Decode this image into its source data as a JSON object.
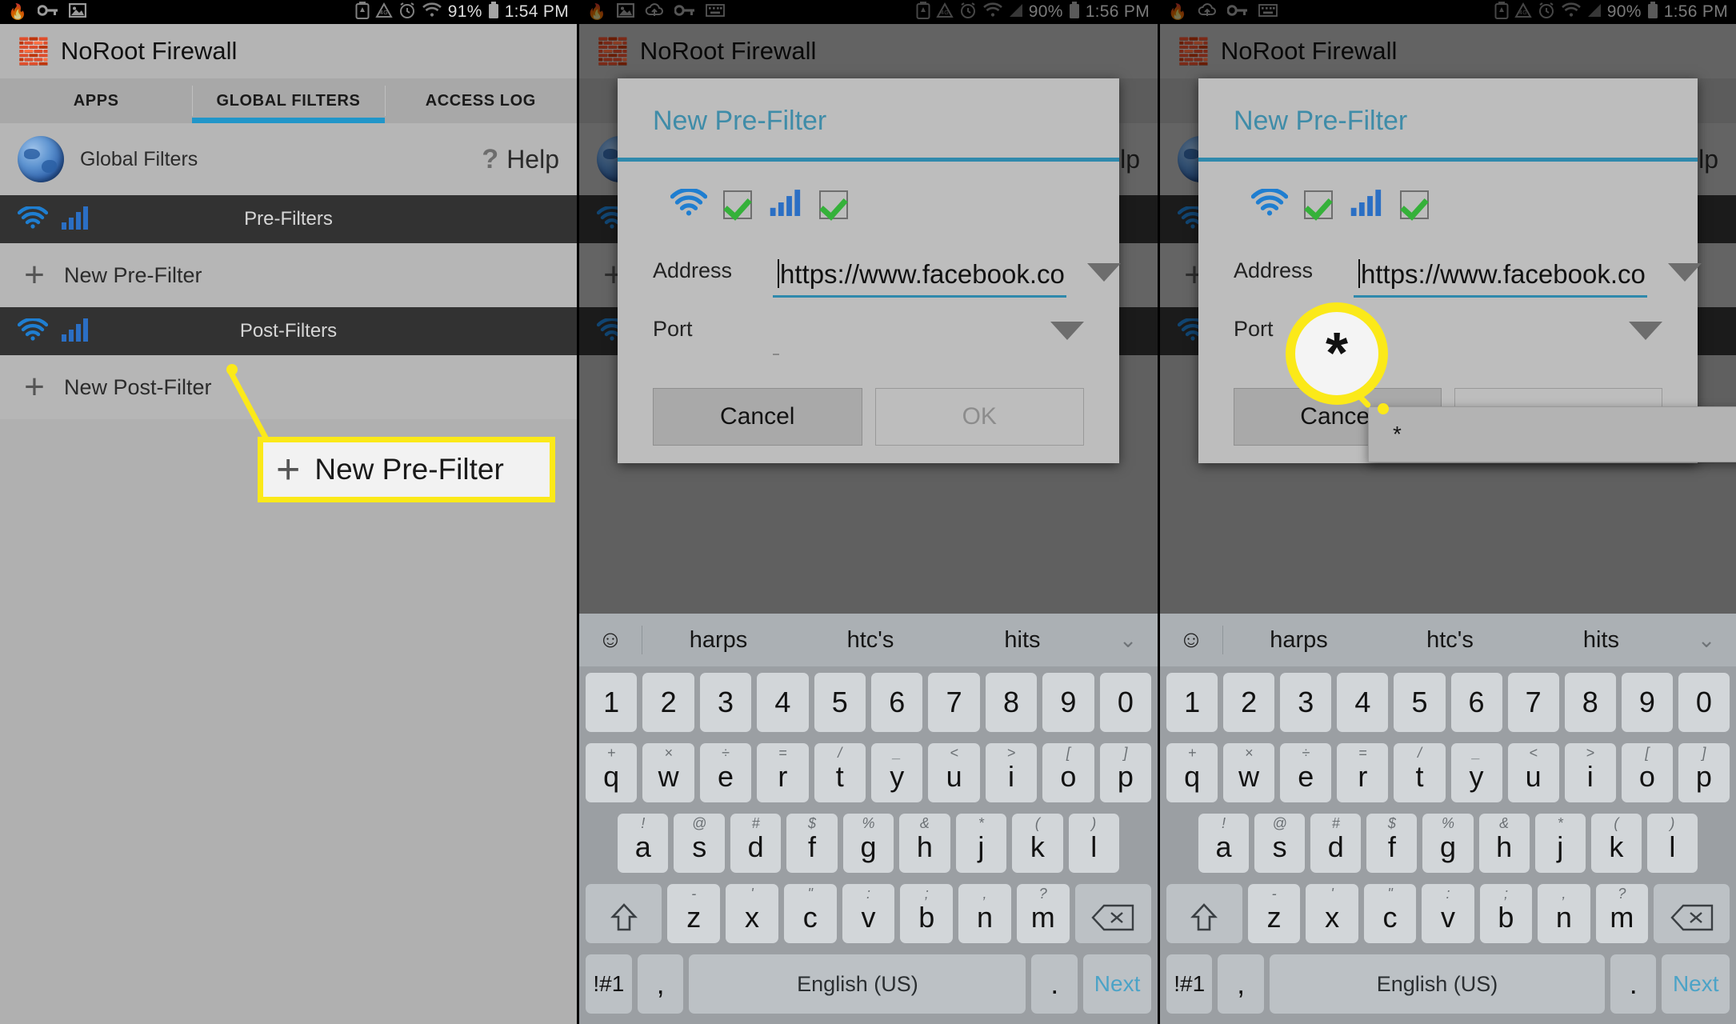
{
  "app": {
    "title": "NoRoot Firewall",
    "icon": "firewall-brick-flame-icon"
  },
  "panels": [
    {
      "id": "panel-1",
      "statusbar": {
        "battery_percent": "91%",
        "time": "1:54 PM",
        "left_icons": [
          "flame-icon",
          "key-icon",
          "image-icon"
        ],
        "right_icons": [
          "battery-saver-icon",
          "data-saver-icon",
          "alarm-icon",
          "wifi-icon",
          "battery-icon"
        ]
      }
    },
    {
      "id": "panel-2",
      "statusbar": {
        "battery_percent": "90%",
        "time": "1:56 PM",
        "left_icons": [
          "flame-icon",
          "image-icon",
          "cloud-upload-icon",
          "key-icon",
          "keyboard-icon"
        ],
        "right_icons": [
          "battery-saver-icon",
          "data-saver-icon",
          "alarm-icon",
          "wifi-icon",
          "signal-icon",
          "battery-icon"
        ]
      }
    },
    {
      "id": "panel-3",
      "statusbar": {
        "battery_percent": "90%",
        "time": "1:56 PM",
        "left_icons": [
          "flame-icon",
          "cloud-upload-icon",
          "key-icon",
          "keyboard-icon"
        ],
        "right_icons": [
          "battery-saver-icon",
          "data-saver-icon",
          "alarm-icon",
          "wifi-icon",
          "signal-icon",
          "battery-icon"
        ]
      }
    }
  ],
  "tabs": [
    {
      "label": "APPS",
      "active": false
    },
    {
      "label": "GLOBAL FILTERS",
      "active": true
    },
    {
      "label": "ACCESS LOG",
      "active": false
    }
  ],
  "global_filters": {
    "row_label": "Global Filters",
    "help_label": "Help",
    "help_icon": "question-mark-icon",
    "globe_icon": "globe-icon"
  },
  "sections": [
    {
      "title": "Pre-Filters",
      "icons": [
        "wifi-icon",
        "signal-bars-icon"
      ],
      "add_label": "New Pre-Filter",
      "add_icon": "plus-icon"
    },
    {
      "title": "Post-Filters",
      "icons": [
        "wifi-icon",
        "signal-bars-icon"
      ],
      "add_label": "New Post-Filter",
      "add_icon": "plus-icon"
    }
  ],
  "callout": {
    "label": "New Pre-Filter",
    "icon": "plus-icon"
  },
  "dialog": {
    "title": "New Pre-Filter",
    "wifi_icon": "wifi-icon",
    "mobile_icon": "signal-bars-icon",
    "wifi_checked": true,
    "mobile_checked": true,
    "address_label": "Address",
    "address_value": "https://www.facebook.co",
    "port_label": "Port",
    "port_value": "",
    "cancel_label": "Cancel",
    "ok_label": "OK",
    "dropdown_icon": "chevron-down-triangle-icon"
  },
  "port_dropdown": {
    "options": [
      "*"
    ],
    "selected": "*"
  },
  "highlight": {
    "panel2_glyph": "triangle-down-icon",
    "panel3_glyph": "*"
  },
  "keyboard": {
    "suggestions": [
      "harps",
      "htc's",
      "hits"
    ],
    "emoji_icon": "emoji-smiley-icon",
    "expand_icon": "chevron-down-icon",
    "rows": [
      {
        "name": "number-row",
        "keys": [
          {
            "main": "1"
          },
          {
            "main": "2"
          },
          {
            "main": "3"
          },
          {
            "main": "4"
          },
          {
            "main": "5"
          },
          {
            "main": "6"
          },
          {
            "main": "7"
          },
          {
            "main": "8"
          },
          {
            "main": "9"
          },
          {
            "main": "0"
          }
        ]
      },
      {
        "name": "qwerty-row",
        "keys": [
          {
            "main": "q",
            "sup": "+"
          },
          {
            "main": "w",
            "sup": "×"
          },
          {
            "main": "e",
            "sup": "÷"
          },
          {
            "main": "r",
            "sup": "="
          },
          {
            "main": "t",
            "sup": "/"
          },
          {
            "main": "y",
            "sup": "_"
          },
          {
            "main": "u",
            "sup": "<"
          },
          {
            "main": "i",
            "sup": ">"
          },
          {
            "main": "o",
            "sup": "["
          },
          {
            "main": "p",
            "sup": "]"
          }
        ]
      },
      {
        "name": "asdf-row",
        "keys": [
          {
            "main": "a",
            "sup": "!"
          },
          {
            "main": "s",
            "sup": "@"
          },
          {
            "main": "d",
            "sup": "#"
          },
          {
            "main": "f",
            "sup": "$"
          },
          {
            "main": "g",
            "sup": "%"
          },
          {
            "main": "h",
            "sup": "&"
          },
          {
            "main": "j",
            "sup": "*"
          },
          {
            "main": "k",
            "sup": "("
          },
          {
            "main": "l",
            "sup": ")"
          }
        ]
      },
      {
        "name": "zxcv-row",
        "keys": [
          {
            "main": "",
            "sup": "",
            "icon": "shift-icon"
          },
          {
            "main": "z",
            "sup": "-"
          },
          {
            "main": "x",
            "sup": "'"
          },
          {
            "main": "c",
            "sup": "\""
          },
          {
            "main": "v",
            "sup": ":"
          },
          {
            "main": "b",
            "sup": ";"
          },
          {
            "main": "n",
            "sup": ","
          },
          {
            "main": "m",
            "sup": "?"
          },
          {
            "main": "",
            "sup": "",
            "icon": "backspace-icon"
          }
        ]
      },
      {
        "name": "bottom-row",
        "keys": [
          {
            "main": "!#1"
          },
          {
            "main": ","
          },
          {
            "main": "English (US)"
          },
          {
            "main": "."
          },
          {
            "main": "Next"
          }
        ]
      }
    ]
  },
  "colors": {
    "accent": "#2f89ac",
    "highlight": "#fbe919",
    "check": "#35b13a",
    "wifi_blue": "#1f7ed0",
    "panel_bg": "#b6b6b6",
    "section_bg": "#323232",
    "next_key": "#4ba3c7"
  }
}
